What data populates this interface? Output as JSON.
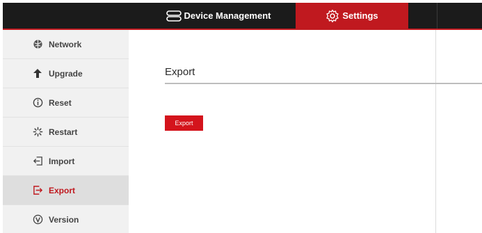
{
  "header": {
    "tabs": [
      {
        "label": "Device Management",
        "icon": "device-icon"
      },
      {
        "label": "Settings",
        "icon": "gear-icon",
        "active": true
      }
    ]
  },
  "sidebar": {
    "items": [
      {
        "label": "Network",
        "icon": "network-icon"
      },
      {
        "label": "Upgrade",
        "icon": "upgrade-arrow-icon"
      },
      {
        "label": "Reset",
        "icon": "info-icon"
      },
      {
        "label": "Restart",
        "icon": "spinner-icon"
      },
      {
        "label": "Import",
        "icon": "import-icon"
      },
      {
        "label": "Export",
        "icon": "export-icon",
        "active": true
      },
      {
        "label": "Version",
        "icon": "version-icon"
      }
    ]
  },
  "main": {
    "title": "Export",
    "export_button": "Export"
  },
  "colors": {
    "accent": "#c0191f",
    "topbar": "#1b1b1b",
    "sidebar": "#f1f1f1"
  }
}
